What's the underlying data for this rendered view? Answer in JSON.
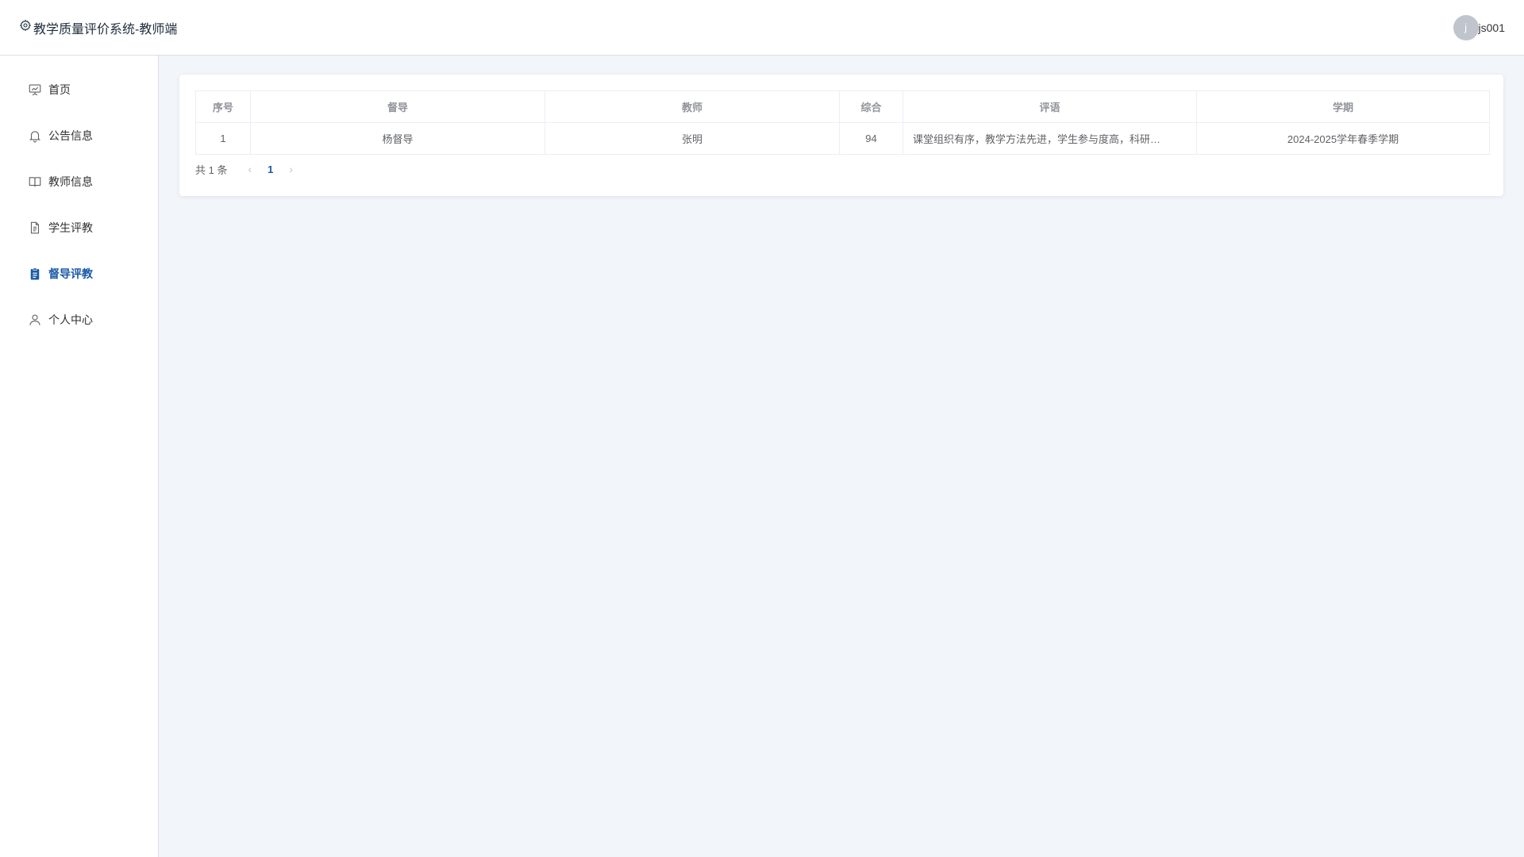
{
  "header": {
    "title": "教学质量评价系统-教师端",
    "avatar_letter": "j",
    "username": "js001"
  },
  "sidebar": {
    "items": [
      {
        "label": "首页",
        "icon": "presentation-icon"
      },
      {
        "label": "公告信息",
        "icon": "bell-icon"
      },
      {
        "label": "教师信息",
        "icon": "book-icon"
      },
      {
        "label": "学生评教",
        "icon": "document-icon"
      },
      {
        "label": "督导评教",
        "icon": "clipboard-icon",
        "active": true
      },
      {
        "label": "个人中心",
        "icon": "user-icon"
      }
    ]
  },
  "table": {
    "headers": [
      "序号",
      "督导",
      "教师",
      "综合",
      "评语",
      "学期"
    ],
    "rows": [
      [
        "1",
        "杨督导",
        "张明",
        "94",
        "课堂组织有序，教学方法先进，学生参与度高，科研…",
        "2024-2025学年春季学期"
      ]
    ]
  },
  "pagination": {
    "total_text": "共 1 条",
    "prev": "‹",
    "current_page": "1",
    "next": "›"
  },
  "colors": {
    "accent": "#1a5aa8",
    "background": "#f2f5f9"
  }
}
